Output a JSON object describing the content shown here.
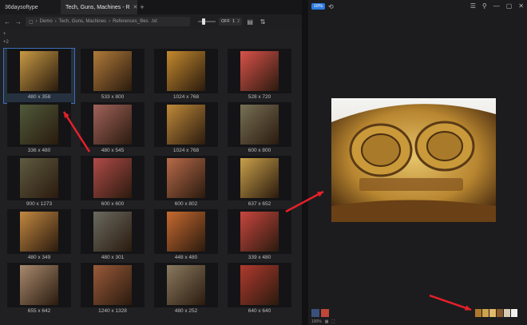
{
  "tabs": [
    {
      "label": "36daysoftype"
    },
    {
      "label": "Tech, Guns, Machines - R"
    }
  ],
  "toolbar": {
    "path_parts": [
      "Demo",
      "Tech, Guns, Machines",
      "References_files"
    ],
    "path_ext": ".txt",
    "zoom_label": "OFF",
    "zoom_a": "1",
    "zoom_b": "2"
  },
  "sidebar_mini": [
    "+",
    "+2"
  ],
  "thumbnails": [
    {
      "caption": "480 x 358",
      "selected": true,
      "tone": "#c79a44"
    },
    {
      "caption": "533 x 800",
      "selected": false,
      "tone": "#b07a3a"
    },
    {
      "caption": "1024 x 768",
      "selected": false,
      "tone": "#c48a2e"
    },
    {
      "caption": "528 x 720",
      "selected": false,
      "tone": "#d9524a"
    },
    {
      "caption": "336 x 480",
      "selected": false,
      "tone": "#4f5a3a"
    },
    {
      "caption": "480 x 545",
      "selected": false,
      "tone": "#a0625a"
    },
    {
      "caption": "1024 x 768",
      "selected": false,
      "tone": "#c08a3a"
    },
    {
      "caption": "600 x 800",
      "selected": false,
      "tone": "#777055"
    },
    {
      "caption": "900 x 1273",
      "selected": false,
      "tone": "#5e5a40"
    },
    {
      "caption": "600 x 600",
      "selected": false,
      "tone": "#b04b48"
    },
    {
      "caption": "600 x 802",
      "selected": false,
      "tone": "#b86a4a"
    },
    {
      "caption": "637 x 652",
      "selected": false,
      "tone": "#c9a04a"
    },
    {
      "caption": "480 x 349",
      "selected": false,
      "tone": "#c28840"
    },
    {
      "caption": "480 x 301",
      "selected": false,
      "tone": "#6a6a60"
    },
    {
      "caption": "448 x 480",
      "selected": false,
      "tone": "#c86a30"
    },
    {
      "caption": "339 x 480",
      "selected": false,
      "tone": "#c8463e"
    },
    {
      "caption": "655 x 642",
      "selected": false,
      "tone": "#a88a6e"
    },
    {
      "caption": "1240 x 1328",
      "selected": false,
      "tone": "#9a5a3a"
    },
    {
      "caption": "480 x 252",
      "selected": false,
      "tone": "#8a7a60"
    },
    {
      "caption": "640 x 640",
      "selected": false,
      "tone": "#b03a2e"
    }
  ],
  "right_toolbar": {
    "badge": "16%",
    "icons": [
      "menu-icon",
      "pin-icon",
      "minimize-icon",
      "maximize-icon",
      "close-icon"
    ]
  },
  "palette": [
    "#b0782c",
    "#cfa24f",
    "#e0b96a",
    "#8a5a2a",
    "#d7cbb3",
    "#f0f0ef"
  ],
  "left_swatches": [
    "#3a4f7a",
    "#c0453a"
  ],
  "status": {
    "zoom": "100%"
  },
  "colors": {
    "accent": "#2d7be0",
    "arrow": "#e8202a",
    "selection": "#3d6fb8"
  }
}
